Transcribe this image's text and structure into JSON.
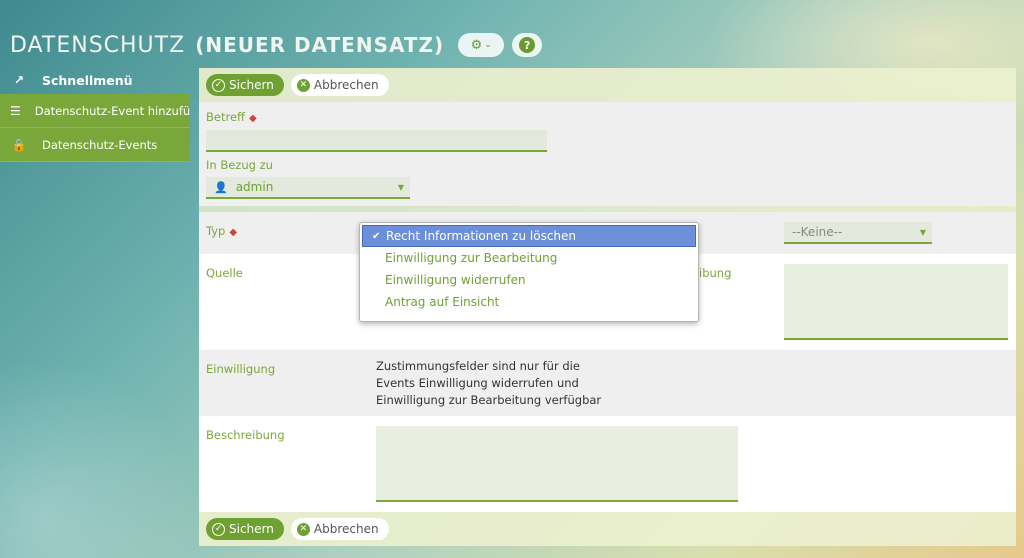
{
  "header": {
    "title": "DATENSCHUTZ",
    "subtitle": "(NEUER DATENSATZ)"
  },
  "sidebar": {
    "items": [
      {
        "label": "Schnellmenü",
        "icon": "trend-icon"
      },
      {
        "label": "Datenschutz-Event hinzufügen",
        "icon": "list-icon"
      },
      {
        "label": "Datenschutz-Events",
        "icon": "lock-icon"
      }
    ]
  },
  "toolbar": {
    "save_label": "Sichern",
    "cancel_label": "Abbrechen"
  },
  "form": {
    "betreff_label": "Betreff",
    "betreff_value": "",
    "bezug_label": "In Bezug zu",
    "bezug_value": "admin",
    "typ_label": "Typ",
    "typ_options": [
      "Recht Informationen zu löschen",
      "Einwilligung zur Bearbeitung",
      "Einwilligung widerrufen",
      "Antrag auf Einsicht"
    ],
    "typ_selected": "Recht Informationen zu löschen",
    "right_select_value": "--Keine--",
    "quelle_label": "Quelle",
    "partial_label": "ibung",
    "einwilligung_label": "Einwilligung",
    "einwilligung_note_1": "Zustimmungsfelder sind nur für die",
    "einwilligung_note_2": "Events Einwilligung widerrufen und",
    "einwilligung_note_3": "Einwilligung zur Bearbeitung verfügbar",
    "beschreibung_label": "Beschreibung"
  },
  "colors": {
    "accent": "#7aa73a",
    "required": "#d0453a",
    "selection": "#6b8fd9"
  }
}
